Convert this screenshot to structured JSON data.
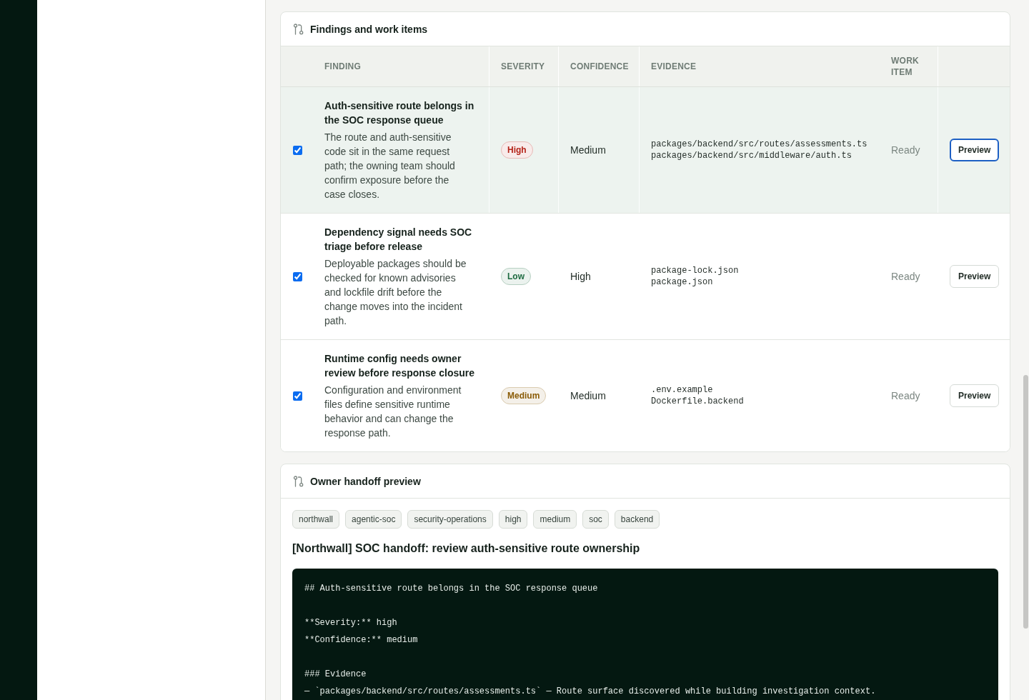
{
  "findings": {
    "title": "Findings and work items",
    "columns": [
      "FINDING",
      "SEVERITY",
      "CONFIDENCE",
      "EVIDENCE",
      "WORK ITEM"
    ],
    "rows": [
      {
        "checked": true,
        "selected": true,
        "title": "Auth-sensitive route belongs in the SOC response queue",
        "description": "The route and auth-sensitive code sit in the same request path; the owning team should confirm exposure before the case closes.",
        "severity": {
          "label": "High",
          "color": "#b42318"
        },
        "confidence": "Medium",
        "evidence": [
          "packages/backend/src/routes/assessments.ts",
          "packages/backend/src/middleware/auth.ts"
        ],
        "work_item": "Ready",
        "action": {
          "label": "Preview",
          "focused": true
        }
      },
      {
        "checked": true,
        "selected": false,
        "title": "Dependency signal needs SOC triage before release",
        "description": "Deployable packages should be checked for known advisories and lockfile drift before the change moves into the incident path.",
        "severity": {
          "label": "Low",
          "color": "#1e6b41"
        },
        "confidence": "High",
        "evidence": [
          "package-lock.json",
          "package.json"
        ],
        "work_item": "Ready",
        "action": {
          "label": "Preview",
          "focused": false
        }
      },
      {
        "checked": true,
        "selected": false,
        "title": "Runtime config needs owner review before response closure",
        "description": "Configuration and environment files define sensitive runtime behavior and can change the response path.",
        "severity": {
          "label": "Medium",
          "color": "#8a5b06"
        },
        "confidence": "Medium",
        "evidence": [
          ".env.example",
          "Dockerfile.backend"
        ],
        "work_item": "Ready",
        "action": {
          "label": "Preview",
          "focused": false
        }
      }
    ]
  },
  "handoff": {
    "title": "Owner handoff preview",
    "tags": [
      "northwall",
      "agentic-soc",
      "security-operations",
      "high",
      "medium",
      "soc",
      "backend"
    ],
    "heading": "[Northwall] SOC handoff: review auth-sensitive route ownership",
    "body": "## Auth-sensitive route belongs in the SOC response queue\n\n**Severity:** high\n**Confidence:** medium\n\n### Evidence\n— `packages/backend/src/routes/assessments.ts` — Route surface discovered while building investigation context."
  }
}
